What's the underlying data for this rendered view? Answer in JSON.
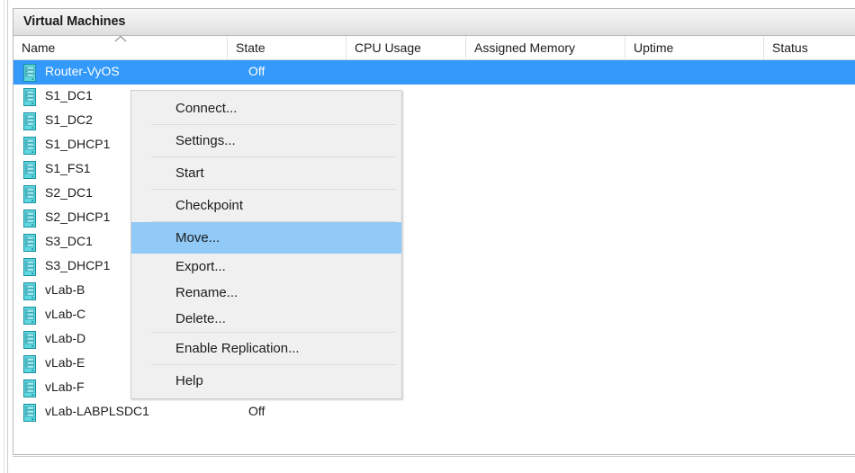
{
  "window": {
    "group_title": "Virtual Machines"
  },
  "colors": {
    "selection_blue": "#3399fb",
    "menu_highlight_blue": "#91c9f7",
    "vm_icon_teal": "#3fd0d8",
    "panel_border": "#b8b8b8"
  },
  "table": {
    "columns": [
      {
        "label": "Name",
        "sorted": "ascending"
      },
      {
        "label": "State",
        "sorted": "none"
      },
      {
        "label": "CPU Usage",
        "sorted": "none"
      },
      {
        "label": "Assigned Memory",
        "sorted": "none"
      },
      {
        "label": "Uptime",
        "sorted": "none"
      },
      {
        "label": "Status",
        "sorted": "none"
      }
    ],
    "rows": [
      {
        "name": "Router-VyOS",
        "state": "Off",
        "cpu_usage": "",
        "assigned_memory": "",
        "uptime": "",
        "status": "",
        "selected": true
      },
      {
        "name": "S1_DC1",
        "state": "",
        "cpu_usage": "",
        "assigned_memory": "",
        "uptime": "",
        "status": "",
        "selected": false
      },
      {
        "name": "S1_DC2",
        "state": "",
        "cpu_usage": "",
        "assigned_memory": "",
        "uptime": "",
        "status": "",
        "selected": false
      },
      {
        "name": "S1_DHCP1",
        "state": "",
        "cpu_usage": "",
        "assigned_memory": "",
        "uptime": "",
        "status": "",
        "selected": false
      },
      {
        "name": "S1_FS1",
        "state": "",
        "cpu_usage": "",
        "assigned_memory": "",
        "uptime": "",
        "status": "",
        "selected": false
      },
      {
        "name": "S2_DC1",
        "state": "",
        "cpu_usage": "",
        "assigned_memory": "",
        "uptime": "",
        "status": "",
        "selected": false
      },
      {
        "name": "S2_DHCP1",
        "state": "",
        "cpu_usage": "",
        "assigned_memory": "",
        "uptime": "",
        "status": "",
        "selected": false
      },
      {
        "name": "S3_DC1",
        "state": "",
        "cpu_usage": "",
        "assigned_memory": "",
        "uptime": "",
        "status": "",
        "selected": false
      },
      {
        "name": "S3_DHCP1",
        "state": "",
        "cpu_usage": "",
        "assigned_memory": "",
        "uptime": "",
        "status": "",
        "selected": false
      },
      {
        "name": "vLab-B",
        "state": "",
        "cpu_usage": "",
        "assigned_memory": "",
        "uptime": "",
        "status": "",
        "selected": false
      },
      {
        "name": "vLab-C",
        "state": "",
        "cpu_usage": "",
        "assigned_memory": "",
        "uptime": "",
        "status": "",
        "selected": false
      },
      {
        "name": "vLab-D",
        "state": "",
        "cpu_usage": "",
        "assigned_memory": "",
        "uptime": "",
        "status": "",
        "selected": false
      },
      {
        "name": "vLab-E",
        "state": "",
        "cpu_usage": "",
        "assigned_memory": "",
        "uptime": "",
        "status": "",
        "selected": false
      },
      {
        "name": "vLab-F",
        "state": "",
        "cpu_usage": "",
        "assigned_memory": "",
        "uptime": "",
        "status": "",
        "selected": false
      },
      {
        "name": "vLab-LABPLSDC1",
        "state": "Off",
        "cpu_usage": "",
        "assigned_memory": "",
        "uptime": "",
        "status": "",
        "selected": false
      }
    ]
  },
  "context_menu": {
    "items": [
      {
        "label": "Connect...",
        "highlighted": false,
        "separator_after": true,
        "compact": false
      },
      {
        "label": "Settings...",
        "highlighted": false,
        "separator_after": true,
        "compact": false
      },
      {
        "label": "Start",
        "highlighted": false,
        "separator_after": true,
        "compact": false
      },
      {
        "label": "Checkpoint",
        "highlighted": false,
        "separator_after": true,
        "compact": false
      },
      {
        "label": "Move...",
        "highlighted": true,
        "separator_after": false,
        "compact": false
      },
      {
        "label": "Export...",
        "highlighted": false,
        "separator_after": false,
        "compact": true
      },
      {
        "label": "Rename...",
        "highlighted": false,
        "separator_after": false,
        "compact": true
      },
      {
        "label": "Delete...",
        "highlighted": false,
        "separator_after": true,
        "compact": true
      },
      {
        "label": "Enable Replication...",
        "highlighted": false,
        "separator_after": true,
        "compact": false
      },
      {
        "label": "Help",
        "highlighted": false,
        "separator_after": false,
        "compact": false
      }
    ]
  }
}
